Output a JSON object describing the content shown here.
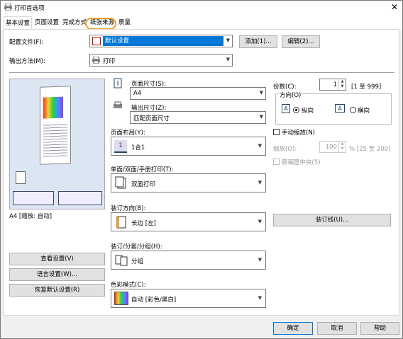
{
  "title": "打印首选项",
  "tabs": [
    "基本设置",
    "页面设置",
    "完成方式",
    "纸张来源",
    "质量"
  ],
  "profile": {
    "label": "配置文件(F):",
    "value": "默认设置",
    "add": "添加(1)...",
    "edit": "编辑(2)..."
  },
  "output": {
    "label": "输出方法(M):",
    "value": "打印"
  },
  "preview": {
    "caption": "A4 [缩放: 自动]"
  },
  "left_buttons": [
    "查看设置(V)",
    "语言设置(W)...",
    "恢复默认设置(R)"
  ],
  "page_size": {
    "label": "页面尺寸(S):",
    "value": "A4"
  },
  "output_size": {
    "label": "输出尺寸(Z):",
    "value": "匹配页面尺寸"
  },
  "layout": {
    "label": "页面布局(Y):",
    "num": "1",
    "value": "1合1"
  },
  "duplex": {
    "label": "单面/双面/手册打印(T):",
    "value": "双面打印"
  },
  "binding": {
    "label": "装订方向(B):",
    "value": "长边 [左]",
    "button": "装订线(U)..."
  },
  "collate": {
    "label": "装订/分套/分组(H):",
    "value": "分组"
  },
  "color": {
    "label": "色彩模式(C):",
    "value": "自动 [彩色/黑白]"
  },
  "copies": {
    "label": "份数(C):",
    "value": "1",
    "range": "[1 至 999]"
  },
  "orientation": {
    "label": "方向(O)",
    "portrait": "纵向",
    "landscape": "横向"
  },
  "manual_scale": {
    "label": "手动缩放(N)",
    "scale_label": "缩放(O):",
    "scale_value": "100",
    "scale_range": "% [25 至 200]",
    "center": "原稿居中央(5)"
  },
  "footer": [
    "确定",
    "取消",
    "帮助"
  ]
}
